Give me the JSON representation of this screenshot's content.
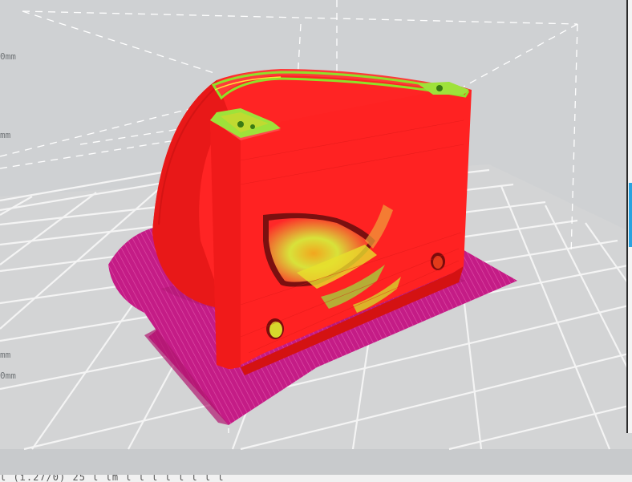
{
  "viewport": {
    "axis_labels": [
      "0mm",
      "mm",
      "mm",
      "0mm"
    ]
  },
  "model": {
    "body_color": "#ff2323",
    "support_color": "#c01c84",
    "infill_color": "#8fe02a"
  },
  "status_bar": {
    "text": "l (i.27/0) 25 l lm l l  l l l l l l"
  }
}
